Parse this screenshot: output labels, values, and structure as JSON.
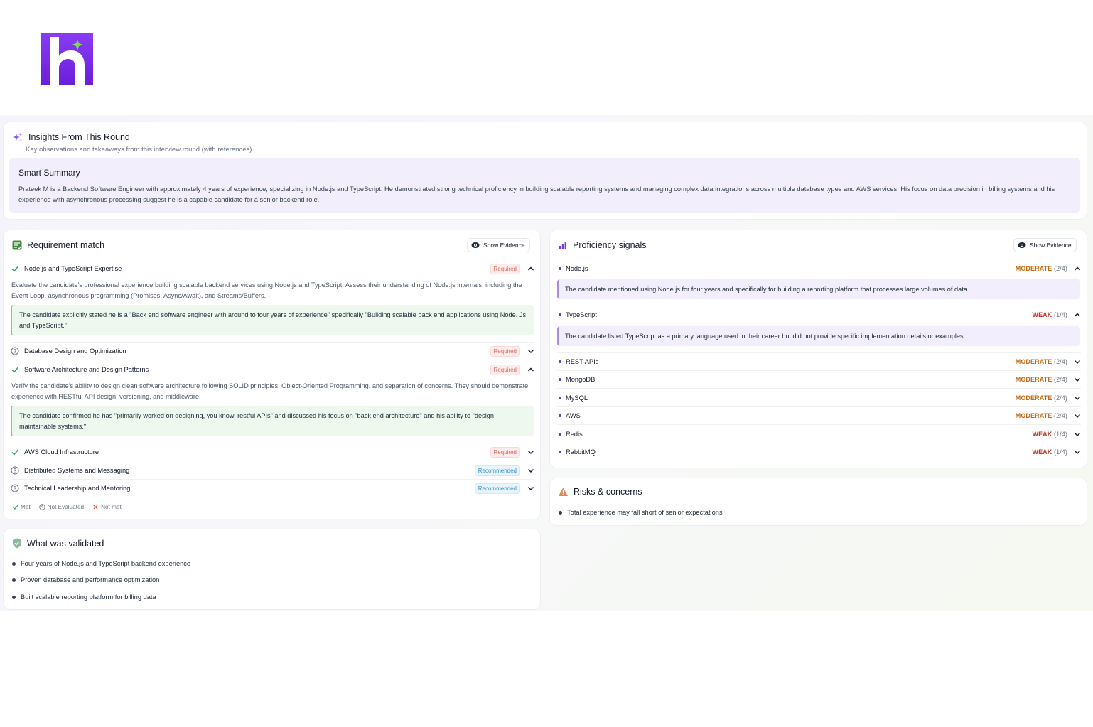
{
  "insights": {
    "title": "Insights From This Round",
    "subtitle": "Key observations and takeaways from this interview round (with references).",
    "summary_title": "Smart Summary",
    "summary_text": "Prateek M is a Backend Software Engineer with approximately 4 years of experience, specializing in Node.js and TypeScript. He demonstrated strong technical proficiency in building scalable reporting systems and managing complex data integrations across multiple database types and AWS services. His focus on data precision in billing systems and his experience with asynchronous processing suggest he is a capable candidate for a senior backend role."
  },
  "requirement_match": {
    "title": "Requirement match",
    "show_evidence": "Show Evidence",
    "items": [
      {
        "label": "Node.js and TypeScript Expertise",
        "status": "met",
        "badge": "Required",
        "expanded": true,
        "description": "Evaluate the candidate's professional experience building scalable backend services using Node.js and TypeScript. Assess their understanding of Node.js internals, including the Event Loop, asynchronous programming (Promises, Async/Await), and Streams/Buffers.",
        "evidence": "The candidate explicitly stated he is a \"Back end software engineer with around to four years of experience\" specifically \"Building scalable back end applications using Node. Js and TypeScript.\""
      },
      {
        "label": "Database Design and Optimization",
        "status": "not-evaluated",
        "badge": "Required",
        "expanded": false
      },
      {
        "label": "Software Architecture and Design Patterns",
        "status": "met",
        "badge": "Required",
        "expanded": true,
        "description": "Verify the candidate's ability to design clean software architecture following SOLID principles, Object-Oriented Programming, and separation of concerns. They should demonstrate experience with RESTful API design, versioning, and middleware.",
        "evidence": "The candidate confirmed he has \"primarily worked on designing, you know, restful APIs\" and discussed his focus on \"back end architecture\" and his ability to \"design maintainable systems.\""
      },
      {
        "label": "AWS Cloud Infrastructure",
        "status": "met",
        "badge": "Required",
        "expanded": false
      },
      {
        "label": "Distributed Systems and Messaging",
        "status": "not-evaluated",
        "badge": "Recommended",
        "expanded": false
      },
      {
        "label": "Technical Leadership and Mentoring",
        "status": "not-evaluated",
        "badge": "Recommended",
        "expanded": false
      }
    ],
    "legend": {
      "met": "Met",
      "not_evaluated": "Not Evaluated",
      "not_met": "Not met"
    }
  },
  "proficiency": {
    "title": "Proficiency signals",
    "show_evidence": "Show Evidence",
    "items": [
      {
        "label": "Node.js",
        "level": "MODERATE",
        "score": "(2/4)",
        "expanded": true,
        "evidence": "The candidate mentioned using Node.js for four years and specifically for building a reporting platform that processes large volumes of data."
      },
      {
        "label": "TypeScript",
        "level": "WEAK",
        "score": "(1/4)",
        "expanded": true,
        "evidence": "The candidate listed TypeScript as a primary language used in their career but did not provide specific implementation details or examples."
      },
      {
        "label": "REST APIs",
        "level": "MODERATE",
        "score": "(2/4)",
        "expanded": false
      },
      {
        "label": "MongoDB",
        "level": "MODERATE",
        "score": "(2/4)",
        "expanded": false
      },
      {
        "label": "MySQL",
        "level": "MODERATE",
        "score": "(2/4)",
        "expanded": false
      },
      {
        "label": "AWS",
        "level": "MODERATE",
        "score": "(2/4)",
        "expanded": false
      },
      {
        "label": "Redis",
        "level": "WEAK",
        "score": "(1/4)",
        "expanded": false
      },
      {
        "label": "RabbitMQ",
        "level": "WEAK",
        "score": "(1/4)",
        "expanded": false
      }
    ]
  },
  "risks": {
    "title": "Risks & concerns",
    "items": [
      "Total experience may fall short of senior expectations"
    ]
  },
  "validated": {
    "title": "What was validated",
    "items": [
      "Four years of Node.js and TypeScript backend experience",
      "Proven database and performance optimization",
      "Built scalable reporting platform for billing data"
    ]
  },
  "colors": {
    "brand": "#7b2ff0",
    "moderate": "#c26a10",
    "weak": "#c0392b",
    "met": "#22a55b"
  }
}
